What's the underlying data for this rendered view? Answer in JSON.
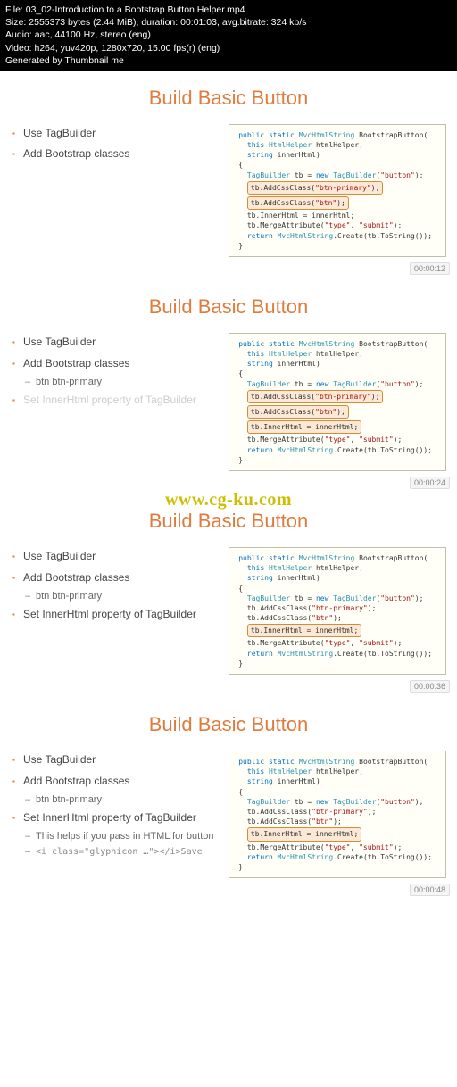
{
  "meta": {
    "file": "File: 03_02-Introduction to a Bootstrap Button Helper.mp4",
    "size": "Size: 2555373 bytes (2.44 MiB), duration: 00:01:03, avg.bitrate: 324 kb/s",
    "audio": "Audio: aac, 44100 Hz, stereo (eng)",
    "video": "Video: h264, yuv420p, 1280x720, 15.00 fps(r) (eng)",
    "gen": "Generated by Thumbnail me"
  },
  "watermark": "www.cg-ku.com",
  "slides": [
    {
      "title": "Build Basic Button",
      "timestamp": "00:00:12",
      "bullets": [
        {
          "level": 1,
          "text": "Use TagBuilder"
        },
        {
          "level": 1,
          "text": "Add Bootstrap classes"
        }
      ],
      "highlight_line": 1,
      "code_lines": [
        "public static MvcHtmlString BootstrapButton(",
        "  this HtmlHelper htmlHelper,",
        "  string innerHtml)",
        "{",
        "  TagBuilder tb = new TagBuilder(\"button\");",
        "",
        "  tb.AddCssClass(\"btn-primary\");",
        "  tb.AddCssClass(\"btn\");",
        "",
        "  tb.InnerHtml = innerHtml;",
        "",
        "  tb.MergeAttribute(\"type\", \"submit\");",
        "",
        "  return MvcHtmlString.Create(tb.ToString());",
        "}"
      ]
    },
    {
      "title": "Build Basic Button",
      "timestamp": "00:00:24",
      "bullets": [
        {
          "level": 1,
          "text": "Use TagBuilder"
        },
        {
          "level": 1,
          "text": "Add Bootstrap classes"
        },
        {
          "level": 2,
          "text": "btn btn-primary"
        },
        {
          "level": 1,
          "text": "Set InnerHtml property of TagBuilder",
          "faded": true
        }
      ],
      "highlight_line": 2,
      "code_lines": [
        "public static MvcHtmlString BootstrapButton(",
        "  this HtmlHelper htmlHelper,",
        "  string innerHtml)",
        "{",
        "  TagBuilder tb = new TagBuilder(\"button\");",
        "",
        "  tb.AddCssClass(\"btn-primary\");",
        "  tb.AddCssClass(\"btn\");",
        "",
        "  tb.InnerHtml = innerHtml;",
        "",
        "  tb.MergeAttribute(\"type\", \"submit\");",
        "",
        "  return MvcHtmlString.Create(tb.ToString());",
        "}"
      ]
    },
    {
      "title": "Build Basic Button",
      "timestamp": "00:00:36",
      "bullets": [
        {
          "level": 1,
          "text": "Use TagBuilder"
        },
        {
          "level": 1,
          "text": "Add Bootstrap classes"
        },
        {
          "level": 2,
          "text": "btn btn-primary"
        },
        {
          "level": 1,
          "text": "Set InnerHtml property of TagBuilder"
        }
      ],
      "highlight_line": 3,
      "code_lines": [
        "public static MvcHtmlString BootstrapButton(",
        "  this HtmlHelper htmlHelper,",
        "  string innerHtml)",
        "{",
        "  TagBuilder tb = new TagBuilder(\"button\");",
        "",
        "  tb.AddCssClass(\"btn-primary\");",
        "  tb.AddCssClass(\"btn\");",
        "",
        "  tb.InnerHtml = innerHtml;",
        "",
        "  tb.MergeAttribute(\"type\", \"submit\");",
        "",
        "  return MvcHtmlString.Create(tb.ToString());",
        "}"
      ]
    },
    {
      "title": "Build Basic Button",
      "timestamp": "00:00:48",
      "bullets": [
        {
          "level": 1,
          "text": "Use TagBuilder"
        },
        {
          "level": 1,
          "text": "Add Bootstrap classes"
        },
        {
          "level": 2,
          "text": "btn btn-primary"
        },
        {
          "level": 1,
          "text": "Set InnerHtml property of TagBuilder"
        },
        {
          "level": 2,
          "text": "This helps if you pass in HTML for button"
        },
        {
          "level": 2,
          "text": "<i class=\"glyphicon …\"></i>Save",
          "code": true
        }
      ],
      "highlight_line": 3,
      "code_lines": [
        "public static MvcHtmlString BootstrapButton(",
        "  this HtmlHelper htmlHelper,",
        "  string innerHtml)",
        "{",
        "  TagBuilder tb = new TagBuilder(\"button\");",
        "",
        "  tb.AddCssClass(\"btn-primary\");",
        "  tb.AddCssClass(\"btn\");",
        "",
        "  tb.InnerHtml = innerHtml;",
        "",
        "  tb.MergeAttribute(\"type\", \"submit\");",
        "",
        "  return MvcHtmlString.Create(tb.ToString());",
        "}"
      ]
    }
  ]
}
